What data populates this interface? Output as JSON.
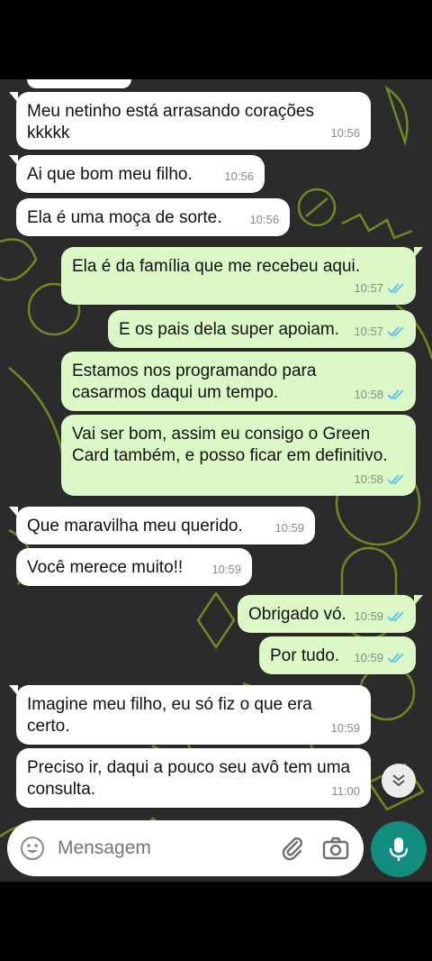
{
  "messages": [
    {
      "text": "Meu netinho está arrasando corações\nkkkkk",
      "time": "10:56",
      "dir": "in"
    },
    {
      "text": "Ai que bom meu filho.",
      "time": "10:56",
      "dir": "in"
    },
    {
      "text": "Ela é uma moça de sorte.",
      "time": "10:56",
      "dir": "in"
    },
    {
      "text": "Ela é da família que me recebeu aqui.",
      "time": "10:57",
      "dir": "out"
    },
    {
      "text": "E os pais dela super apoiam.",
      "time": "10:57",
      "dir": "out"
    },
    {
      "text": "Estamos nos programando para\ncasarmos daqui um tempo.",
      "time": "10:58",
      "dir": "out"
    },
    {
      "text": "Vai ser bom, assim eu consigo o Green\nCard também, e posso ficar em definitivo.",
      "time": "10:58",
      "dir": "out"
    },
    {
      "text": "Que maravilha meu querido.",
      "time": "10:59",
      "dir": "in"
    },
    {
      "text": "Você merece muito!!",
      "time": "10:59",
      "dir": "in"
    },
    {
      "text": "Obrigado vó.",
      "time": "10:59",
      "dir": "out"
    },
    {
      "text": "Por tudo.",
      "time": "10:59",
      "dir": "out"
    },
    {
      "text": "Imagine meu filho, eu só fiz o que era\ncerto.",
      "time": "10:59",
      "dir": "in"
    },
    {
      "text": "Preciso ir, daqui a pouco seu avô tem uma\nconsulta.",
      "time": "11:00",
      "dir": "in"
    }
  ],
  "input": {
    "placeholder": "Mensagem"
  },
  "colors": {
    "incoming": "#ffffff",
    "outgoing": "#dcf8c6",
    "read_ticks": "#4fc3f7",
    "mic_button": "#128c7e",
    "wallpaper_lines": "#a4d81e"
  },
  "icons": {
    "emoji": "emoji-icon",
    "attach": "paperclip-icon",
    "camera": "camera-icon",
    "mic": "mic-icon",
    "scroll": "double-chevron-down-icon"
  }
}
